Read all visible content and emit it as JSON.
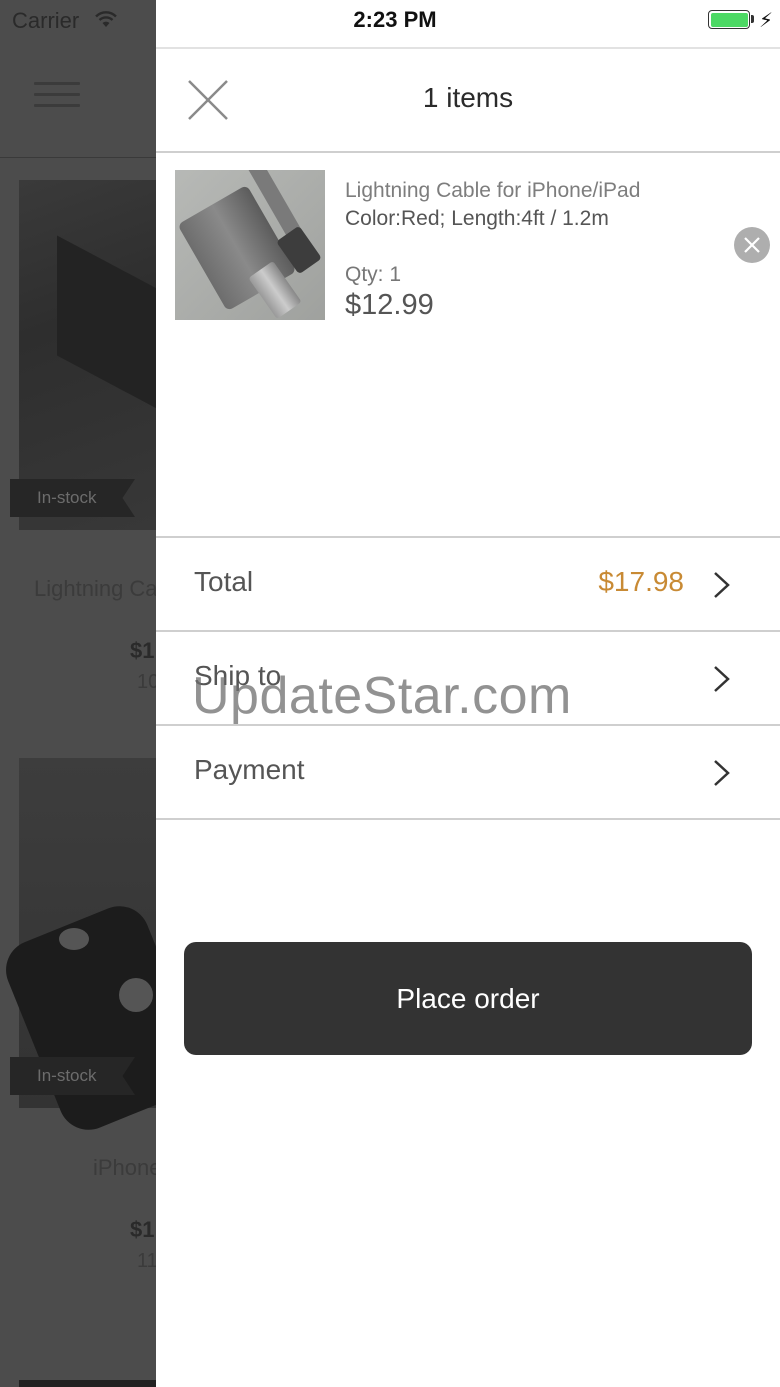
{
  "status_bar": {
    "carrier": "Carrier",
    "time": "2:23 PM",
    "battery_level": 1.0,
    "charging_symbol": "⚡"
  },
  "background_shop": {
    "products": [
      {
        "badge": "In-stock",
        "name": "Lightning Ca",
        "price": "$1",
        "sold": "10"
      },
      {
        "badge": "In-stock",
        "name": "iPhone",
        "price": "$1",
        "sold": "11"
      }
    ]
  },
  "cart": {
    "title": "1 items",
    "items": [
      {
        "name": "Lightning Cable for iPhone/iPad",
        "variant": "Color:Red; Length:4ft / 1.2m",
        "qty": "Qty: 1",
        "price": "$12.99",
        "icon": "lightning-cable-photo"
      }
    ],
    "summary": {
      "total_label": "Total",
      "total_value": "$17.98",
      "ship_label": "Ship to",
      "payment_label": "Payment"
    },
    "place_order_label": "Place order"
  },
  "watermark": "UpdateStar.com",
  "colors": {
    "accent_total": "#c88a34",
    "button_bg": "#333333",
    "battery": "#4cd964"
  },
  "icons": [
    "wifi-icon",
    "battery-icon",
    "close-icon",
    "remove-item-icon",
    "chevron-right-icon",
    "hamburger-menu-icon"
  ]
}
